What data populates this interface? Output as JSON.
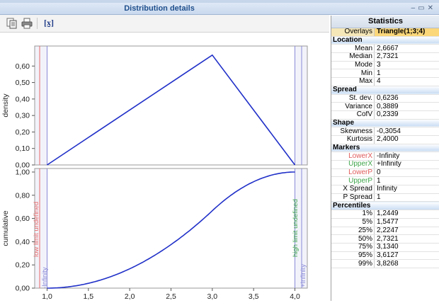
{
  "window": {
    "title": "Distribution details"
  },
  "colors": {
    "curve": "#2030c8",
    "lowerMarker": "#e86a6a",
    "upperMarker": "#8a8ad8",
    "axis": "#555555"
  },
  "toolbar": {
    "copy_icon": "copy-icon",
    "print_icon": "print-icon",
    "formula_label": "[x]"
  },
  "chart_data": [
    {
      "type": "line",
      "title": "",
      "xlabel": "",
      "ylabel": "density",
      "xlim": [
        0.85,
        4.15
      ],
      "ylim": [
        0,
        0.7
      ],
      "ytick_labels": [
        "0,00",
        "0,10",
        "0,20",
        "0,30",
        "0,40",
        "0,50",
        "0,60"
      ],
      "yticks": [
        0,
        0.1,
        0.2,
        0.3,
        0.4,
        0.5,
        0.6
      ],
      "x": [
        1,
        3,
        4
      ],
      "y": [
        0,
        0.6667,
        0
      ]
    },
    {
      "type": "line",
      "title": "",
      "xlabel": "",
      "ylabel": "cumulative",
      "xlim": [
        0.85,
        4.15
      ],
      "ylim": [
        0,
        1.0
      ],
      "ytick_labels": [
        "0,00",
        "0,20",
        "0,40",
        "0,60",
        "0,80",
        "1,00"
      ],
      "yticks": [
        0,
        0.2,
        0.4,
        0.6,
        0.8,
        1.0
      ],
      "xticks": [
        1.0,
        1.5,
        2.0,
        2.5,
        3.0,
        3.5,
        4.0
      ],
      "xtick_labels": [
        "1,0",
        "1,5",
        "2,0",
        "2,5",
        "3,0",
        "3,5",
        "4,0"
      ],
      "function": "triangular-cdf",
      "params": {
        "min": 1,
        "mode": 3,
        "max": 4
      },
      "annotations": {
        "low_limit": "low limit undefined",
        "low_value": "-Infinity",
        "high_limit": "high limit undefined",
        "high_value": "+Infinity"
      }
    }
  ],
  "stats": {
    "title": "Statistics",
    "overlays_label": "Overlays",
    "overlays_value": "Triangle(1;3;4)",
    "sections": [
      {
        "name": "Location",
        "rows": [
          {
            "label": "Mean",
            "value": "2,6667"
          },
          {
            "label": "Median",
            "value": "2,7321"
          },
          {
            "label": "Mode",
            "value": "3"
          },
          {
            "label": "Min",
            "value": "1"
          },
          {
            "label": "Max",
            "value": "4"
          }
        ]
      },
      {
        "name": "Spread",
        "rows": [
          {
            "label": "St. dev.",
            "value": "0,6236"
          },
          {
            "label": "Variance",
            "value": "0,3889"
          },
          {
            "label": "CofV",
            "value": "0,2339"
          }
        ]
      },
      {
        "name": "Shape",
        "rows": [
          {
            "label": "Skewness",
            "value": "-0,3054"
          },
          {
            "label": "Kurtosis",
            "value": "2,4000"
          }
        ]
      },
      {
        "name": "Markers",
        "rows": [
          {
            "label": "LowerX",
            "value": "-Infinity",
            "color": "red"
          },
          {
            "label": "UpperX",
            "value": "+Infinity",
            "color": "green"
          },
          {
            "label": "LowerP",
            "value": "0",
            "color": "red"
          },
          {
            "label": "UpperP",
            "value": "1",
            "color": "green"
          },
          {
            "label": "X Spread",
            "value": " Infinity"
          },
          {
            "label": "P Spread",
            "value": "1"
          }
        ]
      },
      {
        "name": "Percentiles",
        "rows": [
          {
            "label": "1%",
            "value": "1,2449"
          },
          {
            "label": "5%",
            "value": "1,5477"
          },
          {
            "label": "25%",
            "value": "2,2247"
          },
          {
            "label": "50%",
            "value": "2,7321"
          },
          {
            "label": "75%",
            "value": "3,1340"
          },
          {
            "label": "95%",
            "value": "3,6127"
          },
          {
            "label": "99%",
            "value": "3,8268"
          }
        ]
      }
    ]
  }
}
